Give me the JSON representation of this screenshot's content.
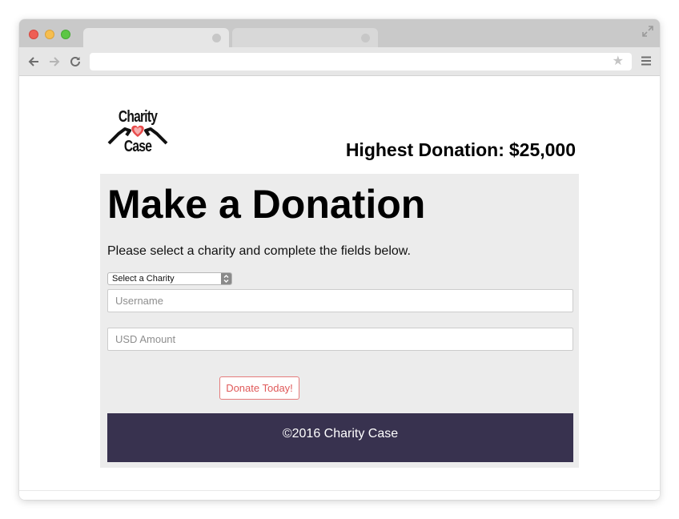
{
  "browser": {
    "icons": {
      "back": "arrow-left-icon",
      "forward": "arrow-right-icon",
      "reload": "reload-icon",
      "bookmark": "star-icon",
      "menu": "hamburger-menu-icon",
      "fullscreen": "expand-icon"
    },
    "address": "",
    "bookmark_glyph": "★"
  },
  "header": {
    "logo": {
      "line1": "Charity",
      "line2": "Case",
      "icon": "heart-hands-icon"
    },
    "highest_label": "Highest Donation:",
    "highest_value": "$25,000"
  },
  "form": {
    "title": "Make a Donation",
    "instructions": "Please select a charity and complete the fields below.",
    "charity_select": {
      "selected": "Select a Charity"
    },
    "username": {
      "value": "",
      "placeholder": "Username"
    },
    "amount": {
      "value": "",
      "placeholder": "USD Amount"
    },
    "submit_label": "Donate Today!"
  },
  "footer": {
    "text": "©2016 Charity Case"
  },
  "colors": {
    "card_bg": "#ececec",
    "footer_bg": "#38324f",
    "accent": "#e05a5a",
    "logo_heart": "#e84c4c"
  }
}
